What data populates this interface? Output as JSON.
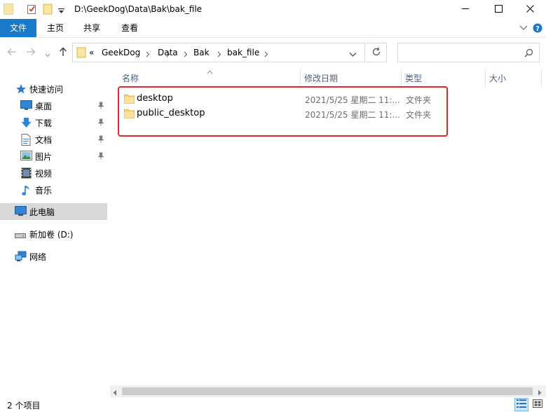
{
  "window": {
    "title": "D:\\GeekDog\\Data\\Bak\\bak_file",
    "minimize_icon": "minimize-icon",
    "maximize_icon": "maximize-icon",
    "close_icon": "close-icon"
  },
  "ribbon": {
    "tabs": [
      {
        "label": "文件"
      },
      {
        "label": "主页"
      },
      {
        "label": "共享"
      },
      {
        "label": "查看"
      }
    ]
  },
  "address": {
    "overflow": "«",
    "crumbs": [
      "GeekDog",
      "Data",
      "Bak",
      "bak_file"
    ],
    "search_placeholder": ""
  },
  "nav": {
    "quick_access": "快速访问",
    "pinned": [
      {
        "label": "桌面",
        "icon": "desktop-icon"
      },
      {
        "label": "下载",
        "icon": "download-icon"
      },
      {
        "label": "文档",
        "icon": "document-icon"
      },
      {
        "label": "图片",
        "icon": "picture-icon"
      }
    ],
    "unpinned": [
      {
        "label": "视频",
        "icon": "video-icon"
      },
      {
        "label": "音乐",
        "icon": "music-icon"
      }
    ],
    "this_pc": "此电脑",
    "drive": "新加卷 (D:)",
    "network": "网络"
  },
  "columns": {
    "name": "名称",
    "modified": "修改日期",
    "type": "类型",
    "size": "大小"
  },
  "files": [
    {
      "name": "desktop",
      "modified": "2021/5/25 星期二 11:...",
      "type": "文件夹"
    },
    {
      "name": "public_desktop",
      "modified": "2021/5/25 星期二 11:...",
      "type": "文件夹"
    }
  ],
  "status": {
    "count": "2 个项目"
  },
  "colors": {
    "accent": "#1979ca",
    "highlight": "#e0262c",
    "folder": "#f8d775"
  }
}
